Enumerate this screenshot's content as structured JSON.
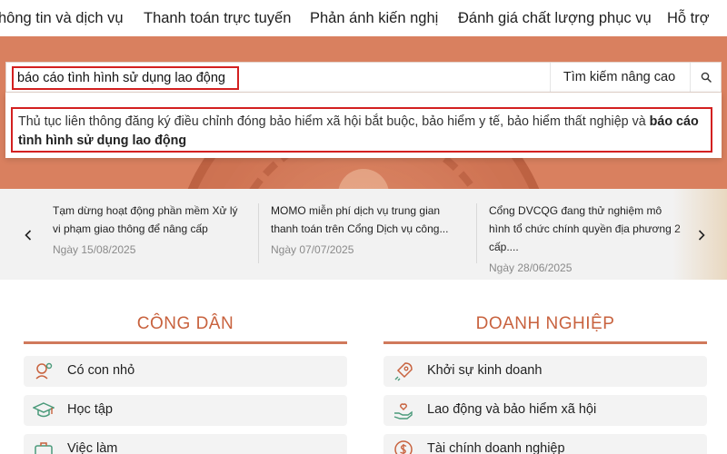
{
  "nav": {
    "items": [
      "hông tin và dịch vụ",
      "Thanh toán trực tuyến",
      "Phản ánh kiến nghị",
      "Đánh giá chất lượng phục vụ",
      "Hỗ trợ"
    ]
  },
  "search": {
    "value": "báo cáo tình hình sử dụng lao động",
    "advanced_label": "Tìm kiếm nâng cao",
    "button_icon": "search-icon"
  },
  "suggestion": {
    "prefix": "Thủ tục liên thông đăng ký điều chỉnh đóng bảo hiểm xã hội bắt buộc, bảo hiểm y tế, bảo hiểm thất nghiệp và ",
    "highlight": "báo cáo tình hình sử dụng lao động"
  },
  "news": {
    "items": [
      {
        "title": "Tạm dừng hoạt động phần mềm Xử lý vi phạm giao thông để nâng cấp",
        "date": "Ngày 15/08/2025"
      },
      {
        "title": "MOMO miễn phí dịch vụ trung gian thanh toán trên Cổng Dịch vụ công...",
        "date": "Ngày 07/07/2025"
      },
      {
        "title": "Cổng DVCQG đang thử nghiệm mô hình tổ chức chính quyền địa phương 2 cấp....",
        "date": "Ngày 28/06/2025"
      }
    ]
  },
  "citizen": {
    "title": "CÔNG DÂN",
    "items": [
      {
        "label": "Có con nhỏ",
        "icon": "baby-icon"
      },
      {
        "label": "Học tập",
        "icon": "graduation-cap-icon"
      },
      {
        "label": "Việc làm",
        "icon": "briefcase-icon"
      }
    ]
  },
  "business": {
    "title": "DOANH NGHIỆP",
    "items": [
      {
        "label": "Khởi sự kinh doanh",
        "icon": "rocket-icon"
      },
      {
        "label": "Lao động và bảo hiểm xã hội",
        "icon": "hand-heart-icon"
      },
      {
        "label": "Tài chính doanh nghiệp",
        "icon": "dollar-coin-icon"
      }
    ]
  },
  "colors": {
    "accent": "#c8623e",
    "hero": "#d9805f",
    "highlight_border": "#d32020"
  }
}
